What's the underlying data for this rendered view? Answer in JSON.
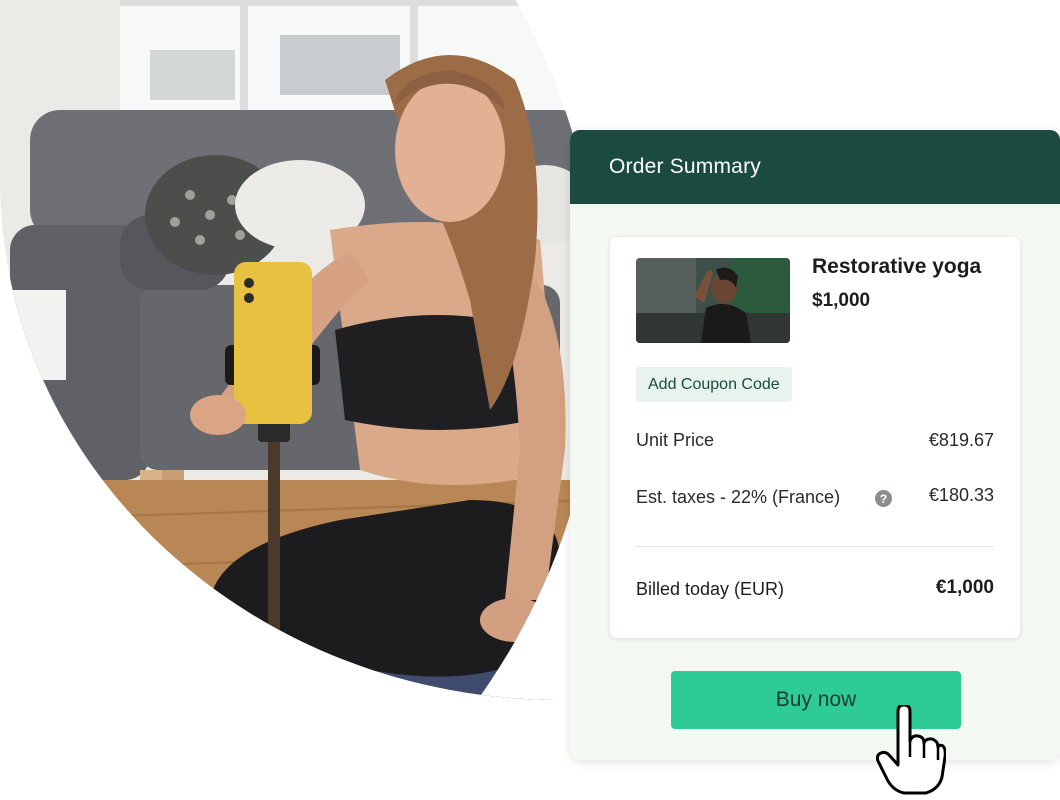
{
  "order": {
    "header_title": "Order Summary",
    "product": {
      "name": "Restorative yoga",
      "price": "$1,000",
      "thumbnail_icon": "yoga-thumbnail"
    },
    "coupon_label": "Add Coupon Code",
    "rows": [
      {
        "label": "Unit Price",
        "value": "€819.67"
      },
      {
        "label": "Est. taxes - 22% (France)",
        "value": "€180.33",
        "help_icon": "question-circle-icon"
      }
    ],
    "total": {
      "label": "Billed today (EUR)",
      "value": "€1,000"
    },
    "buy_label": "Buy now"
  },
  "colors": {
    "header_bg": "#1b4a40",
    "card_bg": "#f4f8f3",
    "buy_button": "#2ecb96",
    "coupon_bg": "#e7f3ec"
  },
  "cursor_icon": "hand-pointer-icon"
}
